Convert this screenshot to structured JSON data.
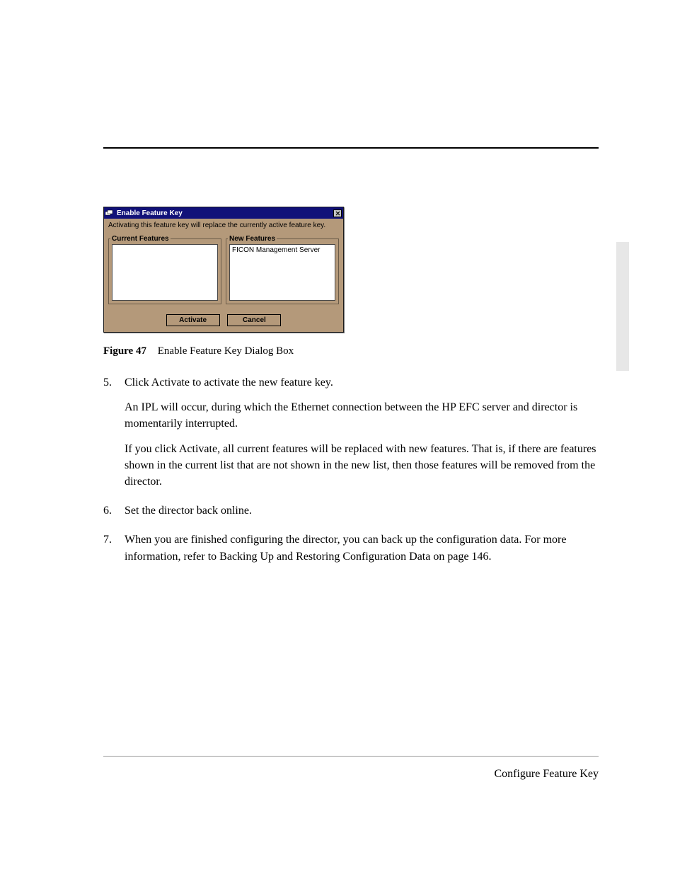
{
  "dialog": {
    "title": "Enable Feature Key",
    "message": "Activating this feature key will replace the currently active feature key.",
    "current_legend": "Current Features",
    "new_legend": "New Features",
    "new_item": "FICON Management Server",
    "activate_label": "Activate",
    "cancel_label": "Cancel"
  },
  "figure": {
    "label": "Figure 47",
    "title": "Enable Feature Key Dialog Box"
  },
  "steps": {
    "s5_num": "5.",
    "s5_a": "Click Activate to activate the new feature key.",
    "s5_b": "An IPL will occur, during which the Ethernet connection between the HP EFC server and director is momentarily interrupted.",
    "s5_c": "If you click Activate, all current features will be replaced with new features. That is, if there are features shown in the current list that are not shown in the new list, then those features will be removed from the director.",
    "s6_num": "6.",
    "s6_a": "Set the director back online.",
    "s7_num": "7.",
    "s7_a": "When you are finished configuring the director, you can back up the configuration data. For more information, refer to Backing Up and Restoring Configuration Data on page 146."
  },
  "footer": "Configure Feature Key"
}
